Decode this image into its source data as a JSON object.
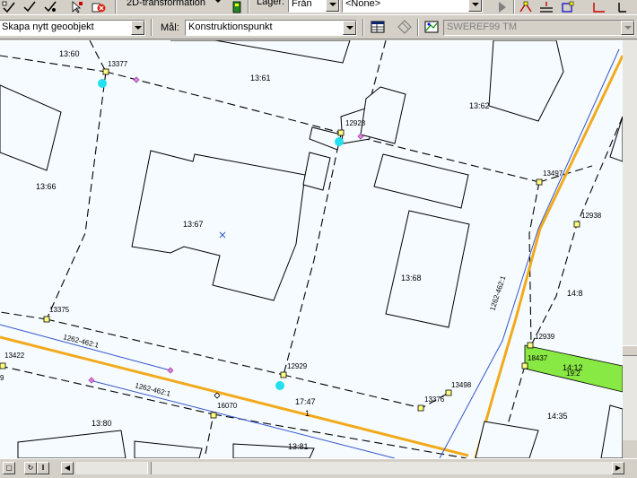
{
  "toolbar_top": {
    "transform_label": "2D-transformation",
    "layer_label": "Lager:",
    "layer_from": "Från",
    "layer_value": "<None>"
  },
  "toolbar_bottom": {
    "create_dropdown": "Skapa nytt geoobjekt",
    "goal_label": "Mål:",
    "goal_value": "Konstruktionspunkt",
    "crs_value": "SWEREF99 TM"
  },
  "map": {
    "colors": {
      "background": "#f5fbff",
      "road": "#f2aa1c",
      "line_blue": "#3355cc",
      "point_cyan": "#22e0f0",
      "parcel_green": "#88e844",
      "vertex_yellow": "#ffff80"
    },
    "parcel_labels": [
      "13:60",
      "13:61",
      "13:62",
      "13:66",
      "13:67",
      "13:68",
      "14:8",
      "13:80",
      "13:81",
      "14:35",
      "17:47",
      "1",
      "14:12",
      "19:2"
    ],
    "point_ids": [
      "13377",
      "12928",
      "13497",
      "12938",
      "13375",
      "13422",
      "12929",
      "16070",
      "13498",
      "13376",
      "12939",
      "18437",
      "9"
    ],
    "line_labels": [
      "1262-462:1",
      "1262-462:1",
      "1262-462:1"
    ]
  }
}
